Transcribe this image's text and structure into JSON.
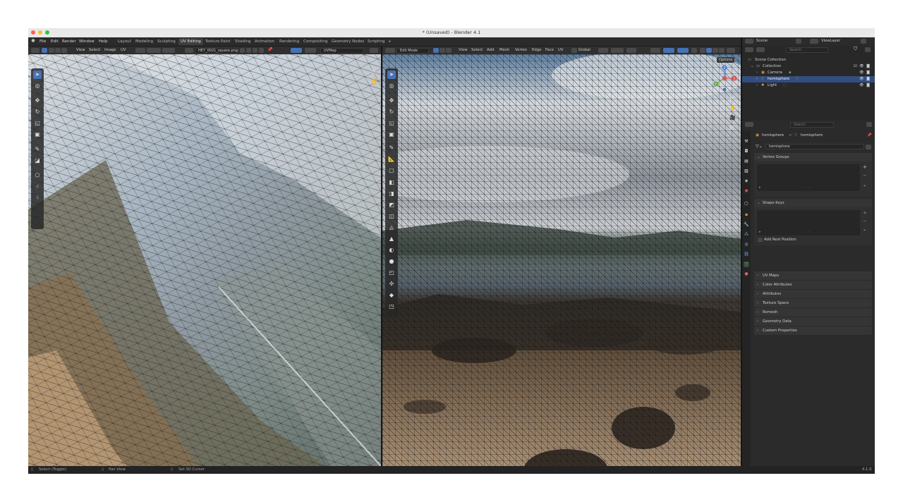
{
  "window": {
    "title": "* (Unsaved) - Blender 4.1"
  },
  "menu": {
    "items": [
      "File",
      "Edit",
      "Render",
      "Window",
      "Help"
    ]
  },
  "workspaces": {
    "tabs": [
      "Layout",
      "Modeling",
      "Sculpting",
      "UV Editing",
      "Texture Paint",
      "Shading",
      "Animation",
      "Rendering",
      "Compositing",
      "Geometry Nodes",
      "Scripting"
    ],
    "active": "UV Editing",
    "add_symbol": "+"
  },
  "scene": {
    "name": "Scene",
    "view_layer": "ViewLayer"
  },
  "uv_editor": {
    "menus": [
      "View",
      "Select",
      "Image",
      "UV"
    ],
    "image_name": "HE7_0021_square.png",
    "uvmap": "UVMap"
  },
  "viewport": {
    "mode": "Edit Mode",
    "menus": [
      "View",
      "Select",
      "Add",
      "Mesh",
      "Vertex",
      "Edge",
      "Face",
      "UV"
    ],
    "orientation": "Global",
    "options_label": "Options",
    "axes": {
      "x": "X",
      "y": "Y",
      "z": "Z"
    }
  },
  "outliner": {
    "search_placeholder": "Search",
    "root": "Scene Collection",
    "collection": "Collection",
    "items": [
      "Camera",
      "hemisphere",
      "Light"
    ],
    "selected": "hemisphere"
  },
  "properties": {
    "search_placeholder": "Search",
    "breadcrumb": {
      "object": "hemisphere",
      "sep": ">",
      "data": "hemisphere"
    },
    "mesh_name": "hemisphere",
    "panels_open": [
      "Vertex Groups",
      "Shape Keys"
    ],
    "add_rest_position": "Add Rest Position",
    "panels_closed": [
      "UV Maps",
      "Color Attributes",
      "Attributes",
      "Texture Space",
      "Remesh",
      "Geometry Data",
      "Custom Properties"
    ]
  },
  "statusbar": {
    "select": "Select (Toggle)",
    "pan": "Pan View",
    "cursor": "Set 3D Cursor",
    "version": "4.1.0"
  },
  "colors": {
    "accent_blue": "#4772b3",
    "selected_row": "#334d80",
    "traffic_red": "#ff5f57",
    "traffic_yellow": "#febc2e",
    "traffic_green": "#28c840"
  },
  "icons": {
    "select_box": "cursor-icon",
    "cursor_3d": "target-icon",
    "move": "move-icon",
    "rotate": "rotate-icon",
    "scale": "scale-icon",
    "transform": "transform-icon",
    "annotate": "pencil-icon",
    "measure": "ruler-icon"
  }
}
